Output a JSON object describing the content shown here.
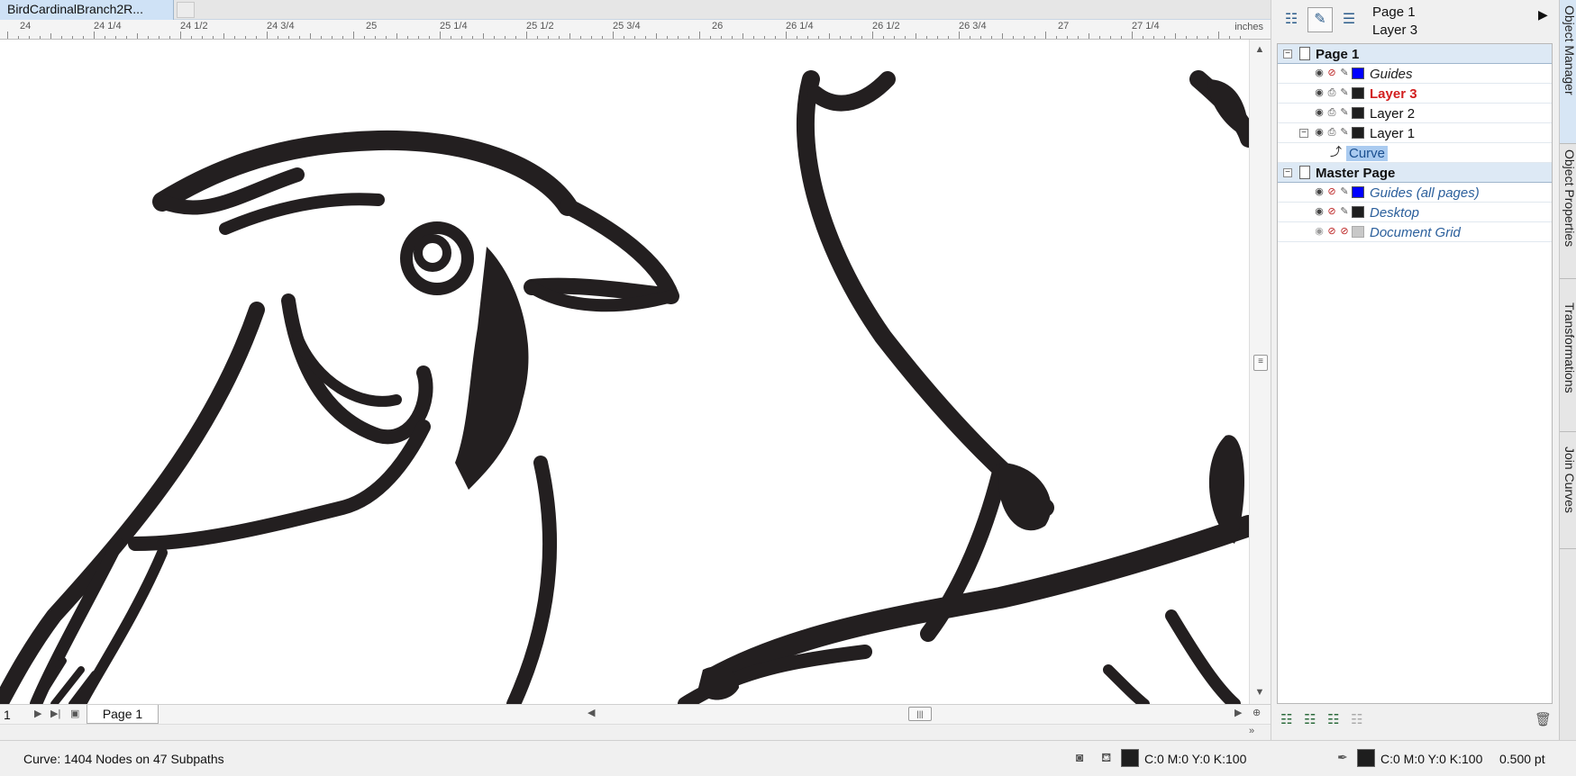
{
  "document": {
    "tab_title": "BirdCardinalBranch2R..."
  },
  "ruler": {
    "unit": "inches",
    "labels": [
      "24",
      "24 1/4",
      "24 1/2",
      "24 3/4",
      "25",
      "25 1/4",
      "25 1/2",
      "25 3/4",
      "26",
      "26 1/4",
      "26 1/2",
      "26 3/4",
      "27",
      "27 1/4"
    ]
  },
  "page_nav": {
    "page_number": "1",
    "page_tab": "Page 1"
  },
  "status": {
    "selection_info": "Curve: 1404 Nodes on 47 Subpaths",
    "fill_text": "C:0 M:0 Y:0 K:100",
    "outline_text": "C:0 M:0 Y:0 K:100",
    "outline_width": "0.500 pt",
    "fill_color": "#1e1e1e",
    "outline_color": "#1e1e1e"
  },
  "object_manager": {
    "header_page": "Page 1",
    "header_layer": "Layer 3",
    "page1": {
      "label": "Page 1",
      "layers": [
        {
          "label": "Guides",
          "color": "#0000ff"
        },
        {
          "label": "Layer 3",
          "color": "#1e1e1e"
        },
        {
          "label": "Layer 2",
          "color": "#1e1e1e"
        },
        {
          "label": "Layer 1",
          "color": "#1e1e1e"
        }
      ],
      "child_object": "Curve"
    },
    "master": {
      "label": "Master Page",
      "layers": [
        {
          "label": "Guides (all pages)",
          "color": "#0000ff"
        },
        {
          "label": "Desktop",
          "color": "#1e1e1e"
        },
        {
          "label": "Document Grid",
          "color": "#c8c8c8"
        }
      ]
    }
  },
  "side_tabs": [
    "Object Manager",
    "Object Properties",
    "Transformations",
    "Join Curves"
  ]
}
